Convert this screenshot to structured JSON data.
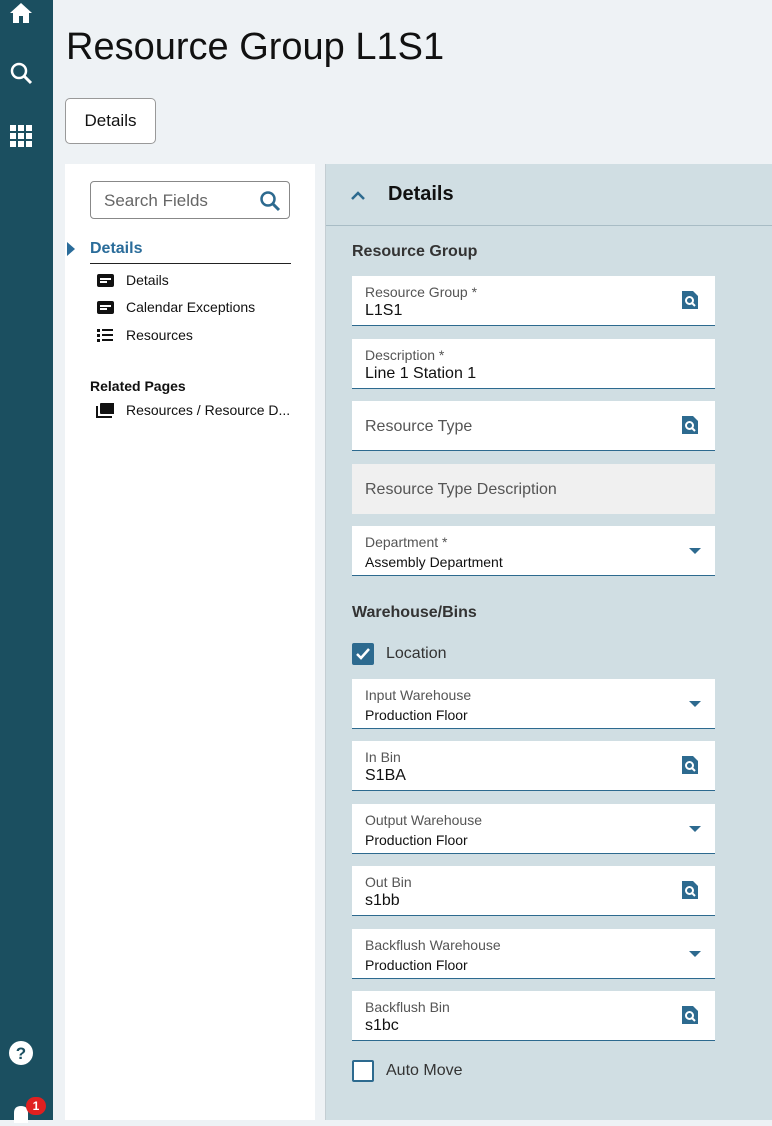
{
  "page": {
    "title": "Resource Group L1S1",
    "details_button": "Details"
  },
  "rail": {
    "badge_count": "1"
  },
  "left": {
    "search_placeholder": "Search Fields",
    "nav_header": "Details",
    "items": [
      {
        "label": "Details",
        "icon": "card-icon"
      },
      {
        "label": "Calendar Exceptions",
        "icon": "card-icon"
      },
      {
        "label": "Resources",
        "icon": "list-icon"
      }
    ],
    "related_header": "Related Pages",
    "related": [
      {
        "label": "Resources / Resource D...",
        "icon": "pages-icon"
      }
    ]
  },
  "main": {
    "panel_title": "Details",
    "section1": "Resource Group",
    "section2": "Warehouse/Bins",
    "fields1": [
      {
        "label": "Resource Group *",
        "value": "L1S1",
        "type": "lookup"
      },
      {
        "label": "Description *",
        "value": "Line 1 Station 1",
        "type": "text"
      },
      {
        "placeholder": "Resource Type",
        "type": "lookup"
      },
      {
        "placeholder": "Resource Type Description",
        "type": "disabled"
      },
      {
        "label": "Department *",
        "value": "Assembly Department",
        "type": "dropdown"
      }
    ],
    "location": {
      "label": "Location",
      "checked": true
    },
    "fields2": [
      {
        "label": "Input Warehouse",
        "value": "Production Floor",
        "type": "dropdown"
      },
      {
        "label": "In Bin",
        "value": "S1BA",
        "type": "lookup"
      },
      {
        "label": "Output Warehouse",
        "value": "Production Floor",
        "type": "dropdown"
      },
      {
        "label": "Out Bin",
        "value": "s1bb",
        "type": "lookup"
      },
      {
        "label": "Backflush Warehouse",
        "value": "Production Floor",
        "type": "dropdown"
      },
      {
        "label": "Backflush Bin",
        "value": "s1bc",
        "type": "lookup"
      }
    ],
    "auto_move": {
      "label": "Auto Move",
      "checked": false
    }
  },
  "colors": {
    "rail": "#1b4f60",
    "accent": "#2d6a8f",
    "panel": "#d0dee3"
  }
}
